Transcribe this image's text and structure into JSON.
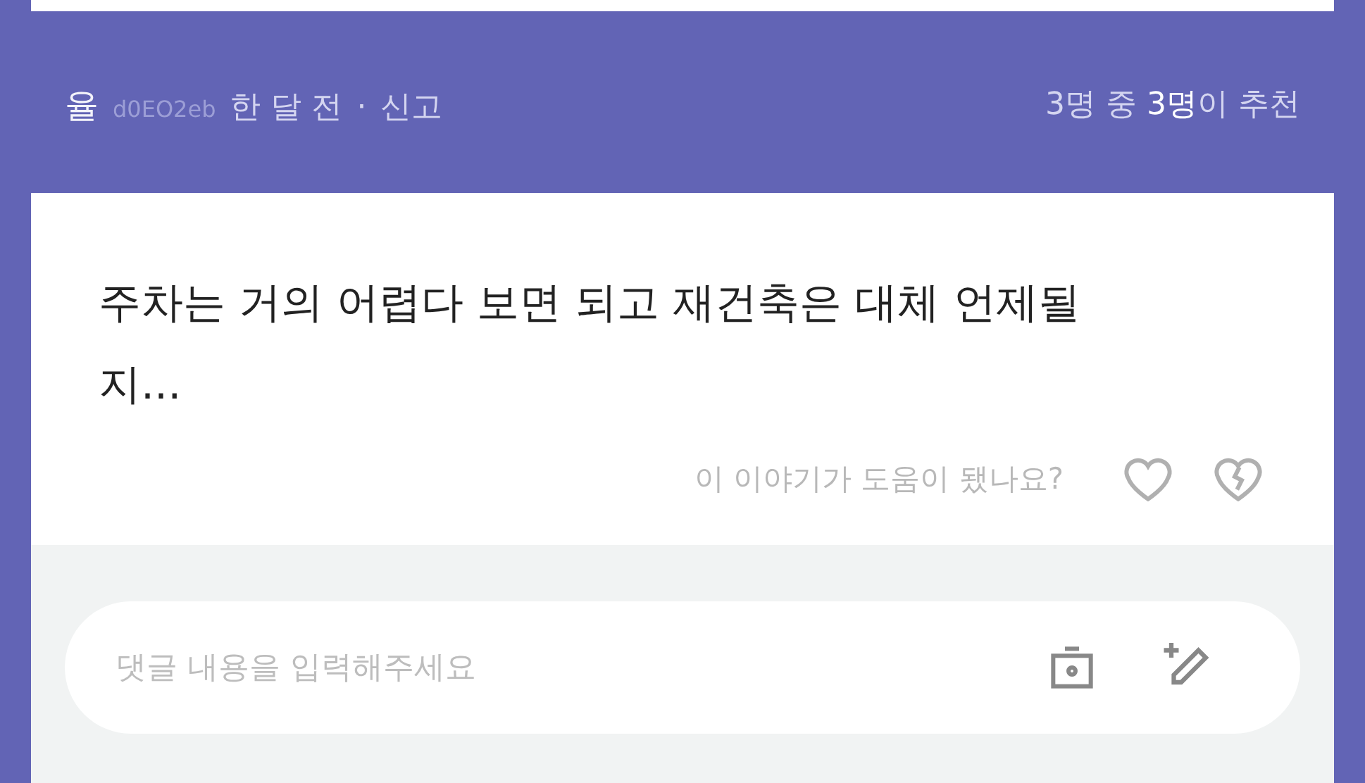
{
  "author": {
    "name": "율",
    "id": "d0EO2eb",
    "time": "한 달 전",
    "separator": "·",
    "report": "신고",
    "recommend": "3명 중 **3명**이 추천"
  },
  "comment": {
    "body": "주차는 거의 어렵다 보면 되고 재건축은 대체 언제될 지...",
    "helpful_prompt": "이 이야기가 도움이 됐나요?"
  },
  "reply_field": {
    "placeholder": "댓글 내용을 입력해주세요"
  }
}
